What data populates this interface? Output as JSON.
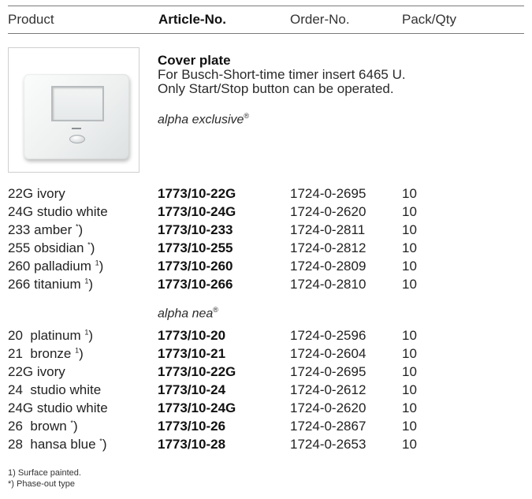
{
  "header": {
    "product": "Product",
    "article": "Article-No.",
    "order": "Order-No.",
    "pack": "Pack/Qty"
  },
  "description": {
    "title": "Cover plate",
    "line1": "For Busch-Short-time timer insert 6465 U.",
    "line2": "Only Start/Stop button can be operated."
  },
  "series": [
    {
      "name": "alpha exclusive",
      "mark": "®",
      "rows": [
        {
          "code": "22G",
          "color": "ivory",
          "note": "",
          "article": "1773/10-22G",
          "order": "1724-0-2695",
          "qty": "10"
        },
        {
          "code": "24G",
          "color": "studio white",
          "note": "",
          "article": "1773/10-24G",
          "order": "1724-0-2620",
          "qty": "10"
        },
        {
          "code": "233",
          "color": "amber",
          "note": "*",
          "article": "1773/10-233",
          "order": "1724-0-2811",
          "qty": "10"
        },
        {
          "code": "255",
          "color": "obsidian",
          "note": "*",
          "article": "1773/10-255",
          "order": "1724-0-2812",
          "qty": "10"
        },
        {
          "code": "260",
          "color": "palladium",
          "note": "1",
          "article": "1773/10-260",
          "order": "1724-0-2809",
          "qty": "10"
        },
        {
          "code": "266",
          "color": "titanium",
          "note": "1",
          "article": "1773/10-266",
          "order": "1724-0-2810",
          "qty": "10"
        }
      ]
    },
    {
      "name": "alpha nea",
      "mark": "®",
      "rows": [
        {
          "code": "20",
          "color": "platinum",
          "note": "1",
          "article": "1773/10-20",
          "order": "1724-0-2596",
          "qty": "10"
        },
        {
          "code": "21",
          "color": "bronze",
          "note": "1",
          "article": "1773/10-21",
          "order": "1724-0-2604",
          "qty": "10"
        },
        {
          "code": "22G",
          "color": "ivory",
          "note": "",
          "article": "1773/10-22G",
          "order": "1724-0-2695",
          "qty": "10"
        },
        {
          "code": "24",
          "color": "studio white",
          "note": "",
          "article": "1773/10-24",
          "order": "1724-0-2612",
          "qty": "10"
        },
        {
          "code": "24G",
          "color": "studio white",
          "note": "",
          "article": "1773/10-24G",
          "order": "1724-0-2620",
          "qty": "10"
        },
        {
          "code": "26",
          "color": "brown",
          "note": "*",
          "article": "1773/10-26",
          "order": "1724-0-2867",
          "qty": "10"
        },
        {
          "code": "28",
          "color": "hansa blue",
          "note": "*",
          "article": "1773/10-28",
          "order": "1724-0-2653",
          "qty": "10"
        }
      ]
    }
  ],
  "footnotes": [
    "1)  Surface painted.",
    "*)  Phase-out type"
  ]
}
